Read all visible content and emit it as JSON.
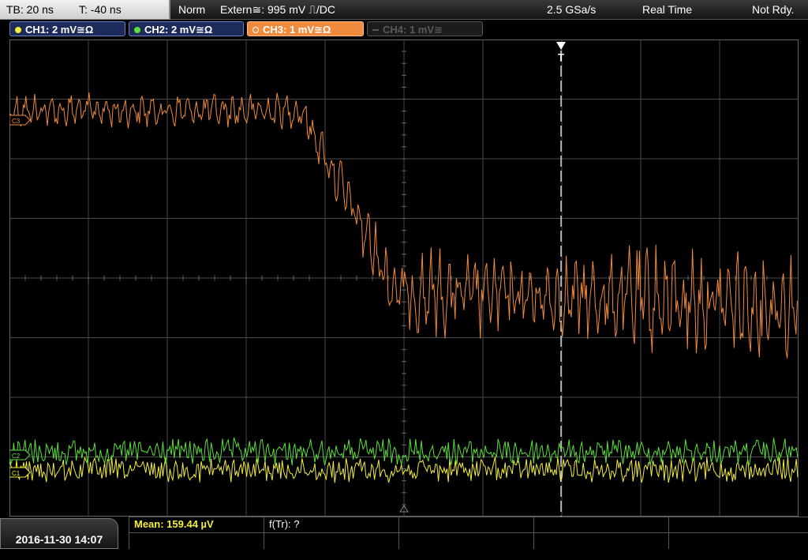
{
  "topbar": {
    "timebase": "TB: 20 ns",
    "trigger_time": "T: -40 ns",
    "trigger_mode": "Norm",
    "trigger_source": "Extern≅: 995 mV ⎍/DC",
    "sample_rate": "2.5 GSa/s",
    "acquisition_mode": "Real Time",
    "status": "Not Rdy."
  },
  "channels": [
    {
      "label": "CH1: 2 mV≅Ω",
      "color": "#f4ee3a",
      "active": true
    },
    {
      "label": "CH2: 2 mV≅Ω",
      "color": "#5be03a",
      "active": true
    },
    {
      "label": "CH3: 1 mV≅Ω",
      "color": "#f08a3c",
      "active": true,
      "selected": true
    },
    {
      "label": "CH4: 1 mV≅",
      "color": "#5a5a5a",
      "active": false
    }
  ],
  "markers": {
    "trigger_marker": "T",
    "ch3_marker": "C3",
    "ch2_marker": "C2",
    "ch1_marker": "C1"
  },
  "bottom": {
    "datetime": "2016-11-30 14:07",
    "measurements": [
      {
        "label": "Mean: 159.44 µV",
        "color": "#f4ee3a"
      },
      {
        "label": "f(Tr): ?",
        "color": "#ffffff"
      }
    ]
  },
  "colors": {
    "grid": "#4a4a4a",
    "ch1": "#f4ee3a",
    "ch2": "#5be03a",
    "ch3": "#f08a3c"
  }
}
